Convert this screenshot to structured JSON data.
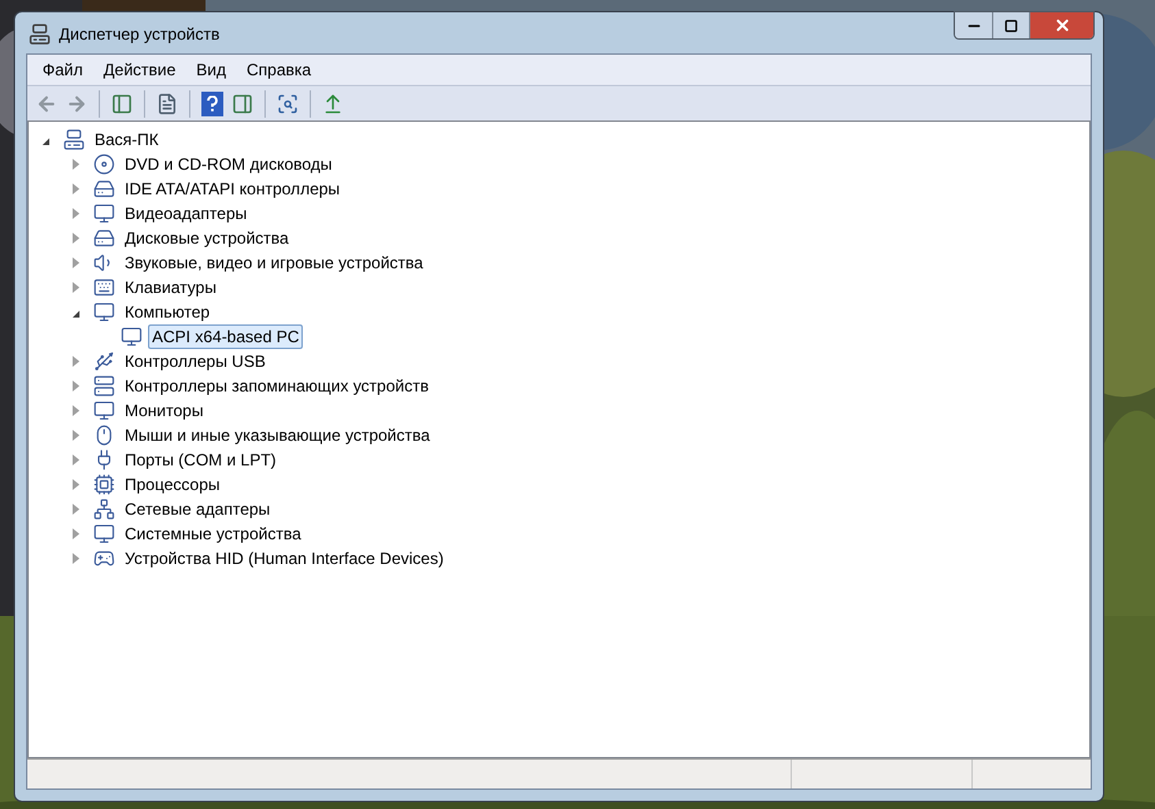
{
  "window": {
    "title": "Диспетчер устройств"
  },
  "menu": [
    {
      "label": "Файл"
    },
    {
      "label": "Действие"
    },
    {
      "label": "Вид"
    },
    {
      "label": "Справка"
    }
  ],
  "tree": {
    "label": "Вася-ПК",
    "expanded": true,
    "selected": false,
    "children": [
      {
        "label": "DVD и CD-ROM дисководы",
        "expanded": false,
        "selected": false
      },
      {
        "label": "IDE ATA/ATAPI контроллеры",
        "expanded": false,
        "selected": false
      },
      {
        "label": "Видеоадаптеры",
        "expanded": false,
        "selected": false
      },
      {
        "label": "Дисковые устройства",
        "expanded": false,
        "selected": false
      },
      {
        "label": "Звуковые, видео и игровые устройства",
        "expanded": false,
        "selected": false
      },
      {
        "label": "Клавиатуры",
        "expanded": false,
        "selected": false
      },
      {
        "label": "Компьютер",
        "expanded": true,
        "selected": false,
        "children": [
          {
            "label": "ACPI x64-based PC",
            "selected": true
          }
        ]
      },
      {
        "label": "Контроллеры USB",
        "expanded": false,
        "selected": false
      },
      {
        "label": "Контроллеры запоминающих устройств",
        "expanded": false,
        "selected": false
      },
      {
        "label": "Мониторы",
        "expanded": false,
        "selected": false
      },
      {
        "label": "Мыши и иные указывающие устройства",
        "expanded": false,
        "selected": false
      },
      {
        "label": "Порты (COM и LPT)",
        "expanded": false,
        "selected": false
      },
      {
        "label": "Процессоры",
        "expanded": false,
        "selected": false
      },
      {
        "label": "Сетевые адаптеры",
        "expanded": false,
        "selected": false
      },
      {
        "label": "Системные устройства",
        "expanded": false,
        "selected": false
      },
      {
        "label": "Устройства HID (Human Interface Devices)",
        "expanded": false,
        "selected": false
      }
    ]
  }
}
